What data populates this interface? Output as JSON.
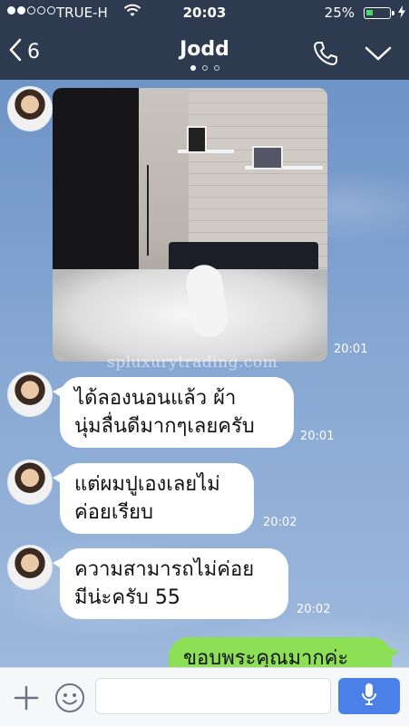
{
  "status_bar": {
    "carrier": "TRUE-H",
    "time": "20:03",
    "battery_percent": "25%",
    "signal_bars_filled": 2,
    "signal_bars_total": 5,
    "battery_level": 0.25
  },
  "header": {
    "back_count": "6",
    "title": "Jodd",
    "page_count": 3,
    "page_active": 0,
    "icons": [
      "back-chevron-icon",
      "phone-icon",
      "chevron-down-icon"
    ]
  },
  "messages": [
    {
      "type": "image",
      "sender": "Jodd",
      "time": "20:01",
      "description_icon": "photo-icon"
    },
    {
      "type": "text",
      "sender": "Jodd",
      "text": "ได้ลองนอนแล้ว ผ้านุ่มลื่นดีมากๆเลยครับ",
      "lines": [
        "ได้ลองนอนแล้ว ผ้า",
        "นุ่มลื่นดีมากๆเลยครับ"
      ],
      "time": "20:01"
    },
    {
      "type": "text",
      "sender": "Jodd",
      "text": "แต่ผมปูเองเลยไม่ค่อยเรียบ",
      "lines": [
        "แต่ผมปูเองเลยไม่",
        "ค่อยเรียบ"
      ],
      "time": "20:02"
    },
    {
      "type": "text",
      "sender": "Jodd",
      "text": "ความสามารถไม่ค่อยมีน่ะครับ 55",
      "lines": [
        "ความสามารถไม่ค่อย",
        "มีน่ะครับ 55"
      ],
      "time": "20:02"
    },
    {
      "type": "text",
      "sender": "me",
      "text": "ขอบพระคุณมากค่ะ",
      "lines": [
        "ขอบพระคุณมากค่ะ"
      ]
    }
  ],
  "watermark": "spluxurytrading.com",
  "input_bar": {
    "placeholder": "",
    "icons": [
      "plus-icon",
      "emoji-icon",
      "microphone-icon"
    ]
  },
  "colors": {
    "header_bg": "#2e3a4f",
    "outgoing_bubble": "#8de055",
    "incoming_bubble": "#ffffff",
    "mic_button": "#4a80e8",
    "battery_fill": "#4cd964"
  }
}
